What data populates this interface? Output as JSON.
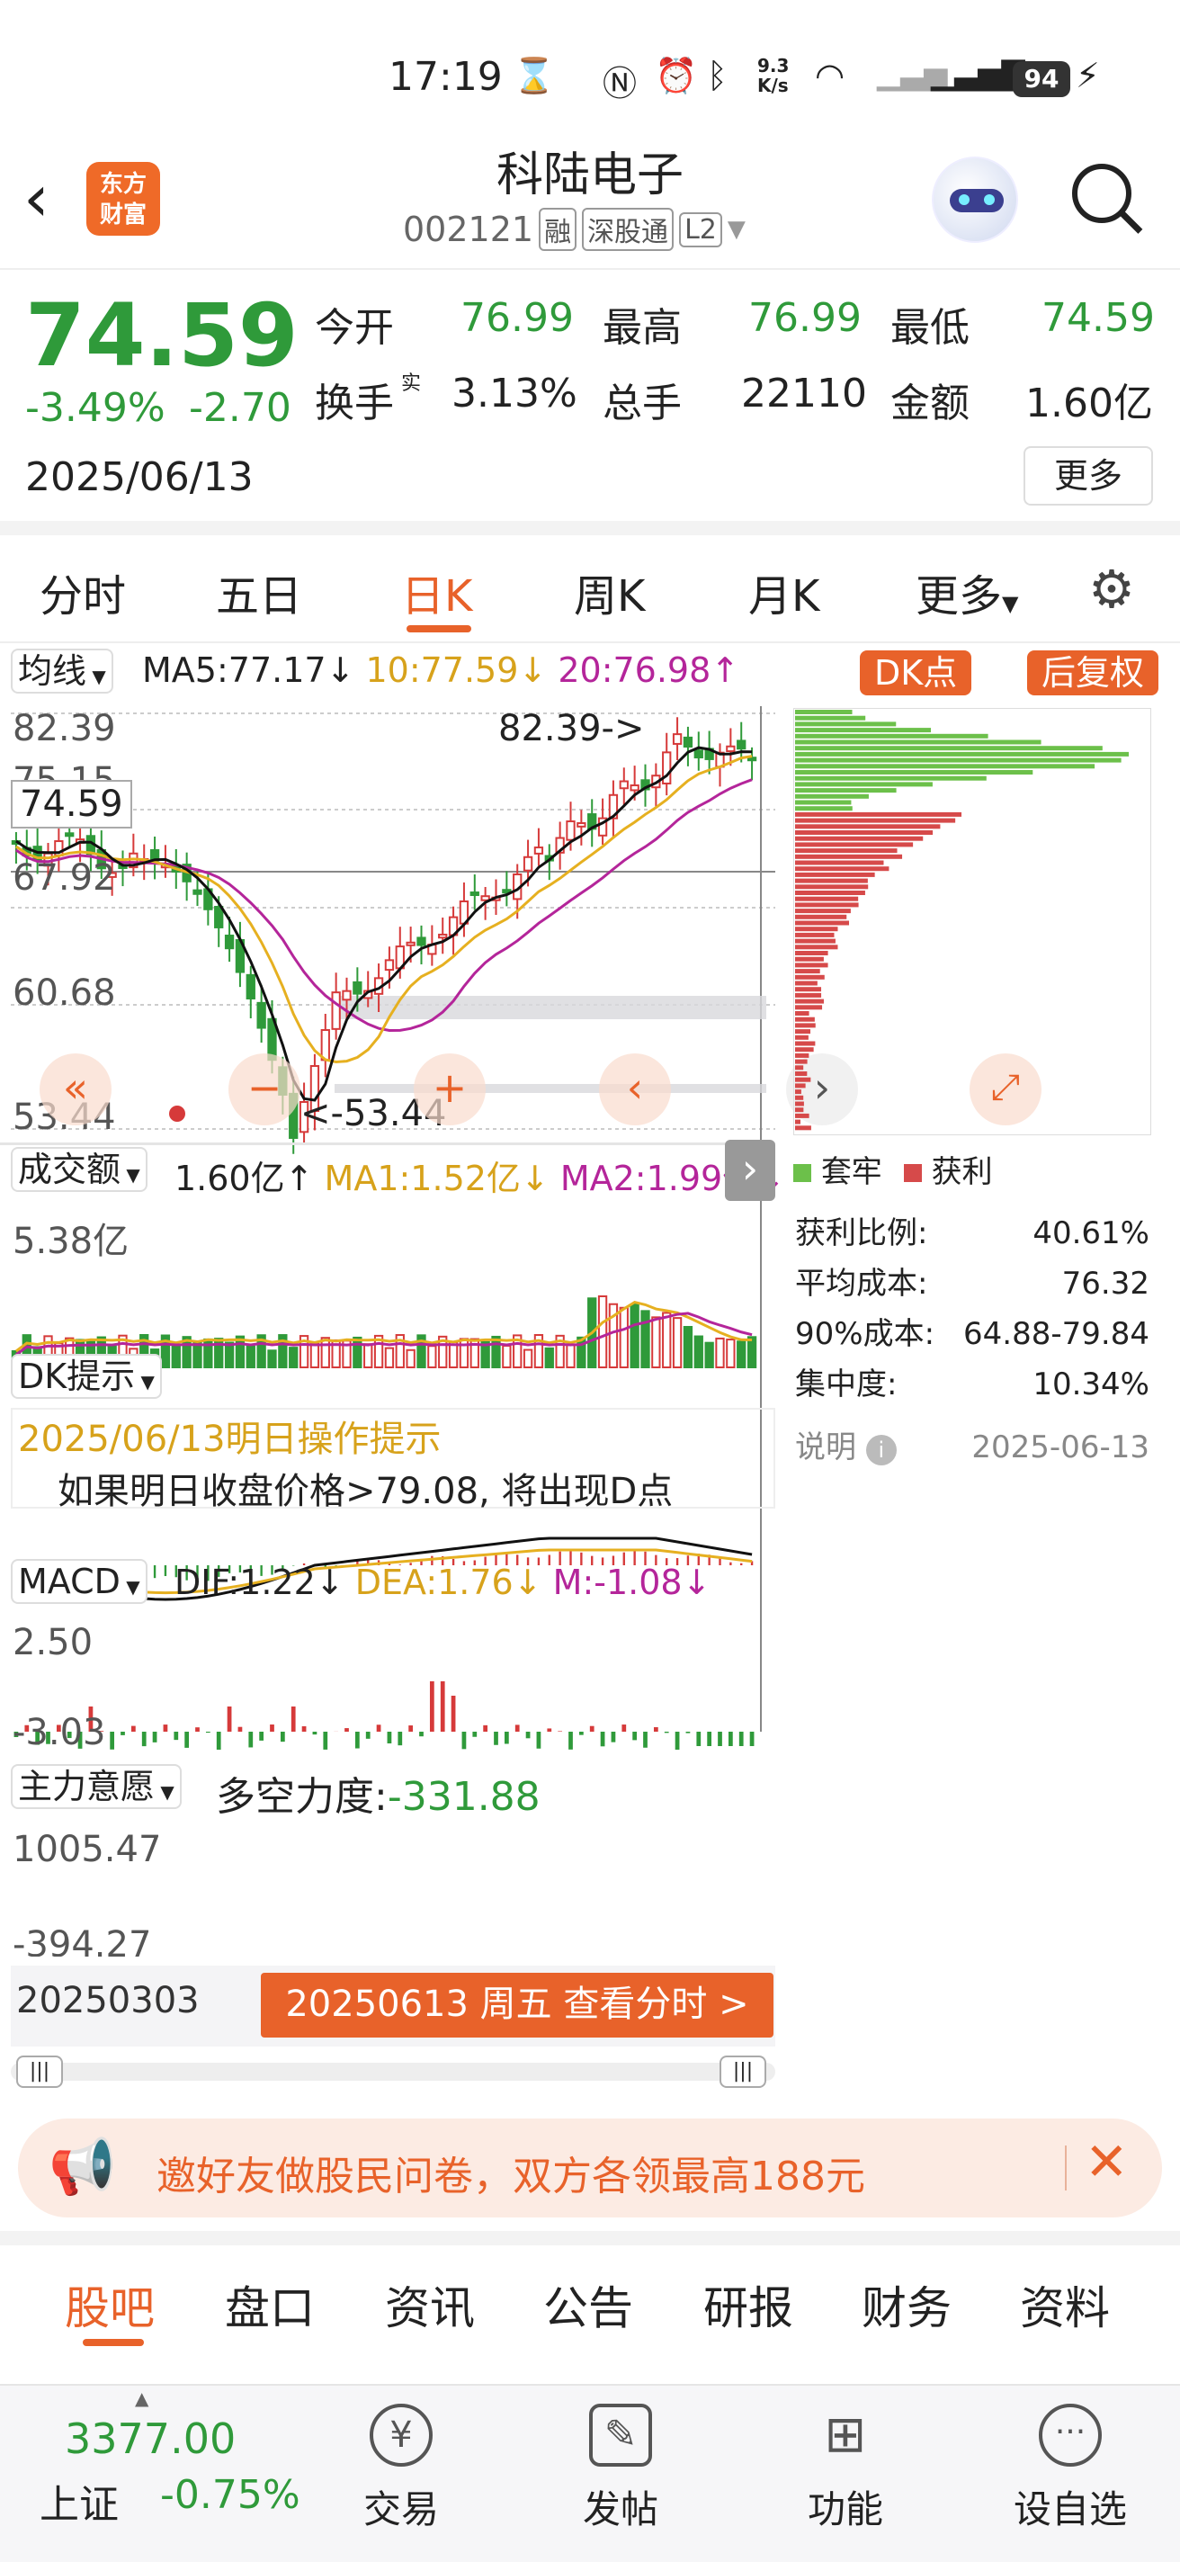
{
  "status": {
    "time": "17:19",
    "net": "9.3\nK/s",
    "battery": "94"
  },
  "header": {
    "title": "科陆电子",
    "code": "002121",
    "tag_margin": "融",
    "tag_sz": "深股通",
    "tag_l2": "L2",
    "logo_line1": "东方",
    "logo_line2": "财富"
  },
  "quote": {
    "price": "74.59",
    "pct": "-3.49%",
    "chg": "-2.70",
    "date": "2025/06/13",
    "open_label": "今开",
    "open": "76.99",
    "high_label": "最高",
    "high": "76.99",
    "low_label": "最低",
    "low": "74.59",
    "turn_label": "换手",
    "turn_sup": "实",
    "turn": "3.13%",
    "vol_label": "总手",
    "vol": "22110",
    "amt_label": "金额",
    "amt": "1.60亿",
    "more": "更多"
  },
  "tabs": [
    "分时",
    "五日",
    "日K",
    "周K",
    "月K",
    "更多"
  ],
  "kline": {
    "ma_sel": "均线",
    "ma5": "MA5:77.17",
    "ma10": "10:77.59",
    "ma20": "20:76.98",
    "dk_btn": "DK点",
    "adj_btn": "后复权",
    "y_top": "82.39",
    "y_2": "75.15",
    "y_3": "67.92",
    "y_4": "60.68",
    "y_bot": "53.44",
    "cursor_price": "74.59",
    "high_note": "82.39->",
    "low_note": "<-53.44"
  },
  "volume": {
    "sel": "成交额",
    "val": "1.60亿",
    "ma1": "MA1:1.52亿",
    "ma2": "MA2:1.99亿",
    "y_top": "5.38亿"
  },
  "dk": {
    "sel": "DK提示",
    "tip_title": "2025/06/13明日操作提示",
    "tip_body": "如果明日收盘价格>79.08, 将出现D点"
  },
  "macd": {
    "sel": "MACD",
    "dif": "DIF:1.22",
    "dea": "DEA:1.76",
    "m": "M:-1.08",
    "y_top": "2.50",
    "y_bot": "-3.03"
  },
  "main": {
    "sel": "主力意愿",
    "label": "多空力度:",
    "val": "-331.88",
    "y_top": "1005.47",
    "y_bot": "-394.27"
  },
  "timeline": {
    "start": "20250303",
    "btn": "20250613 周五 查看分时 >"
  },
  "chip": {
    "legend_trap": "套牢",
    "legend_profit": "获利",
    "rows": [
      {
        "k": "获利比例:",
        "v": "40.61%"
      },
      {
        "k": "平均成本:",
        "v": "76.32"
      },
      {
        "k": "90%成本:",
        "v": "64.88-79.84"
      },
      {
        "k": "集中度:",
        "v": "10.34%"
      }
    ],
    "note": "说明",
    "date": "2025-06-13"
  },
  "banner": {
    "text": "邀好友做股民问卷，双方各领最高188元"
  },
  "subtabs": [
    "股吧",
    "盘口",
    "资讯",
    "公告",
    "研报",
    "财务",
    "资料"
  ],
  "bottom": {
    "index_val": "3377.00",
    "index_name": "上证",
    "index_pct": "-0.75%",
    "trade": "交易",
    "post": "发帖",
    "func": "功能",
    "custom": "设自选"
  },
  "colors": {
    "up": "#d63a3a",
    "down": "#2f9a3a",
    "accent": "#e8622a",
    "ma10": "#e6b020",
    "ma20": "#b4259a"
  }
}
